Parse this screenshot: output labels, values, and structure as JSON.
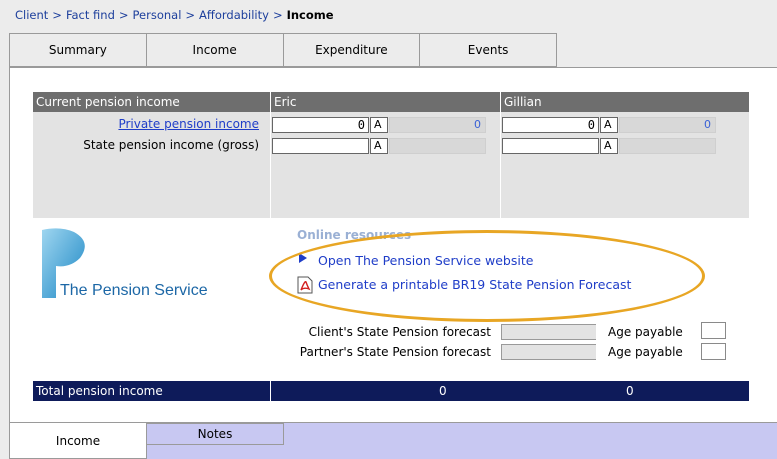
{
  "breadcrumb": {
    "items": [
      "Client",
      "Fact find",
      "Personal",
      "Affordability"
    ],
    "separator": ">",
    "current": "Income"
  },
  "tabs": [
    "Summary",
    "Income",
    "Expenditure",
    "Events"
  ],
  "table": {
    "header": {
      "label": "Current pension income",
      "person1": "Eric",
      "person2": "Gillian"
    },
    "rows": [
      {
        "label": "Private pension income",
        "p1_value": "0",
        "p1_flag": "A",
        "p1_computed": "0",
        "p2_value": "0",
        "p2_flag": "A",
        "p2_computed": "0"
      },
      {
        "label": "State pension income (gross)",
        "p1_value": "",
        "p1_flag": "A",
        "p1_computed": "",
        "p2_value": "",
        "p2_flag": "A",
        "p2_computed": ""
      }
    ]
  },
  "logo": {
    "text": "The Pension Service"
  },
  "resources": {
    "title": "Online resources",
    "links": [
      "Open The Pension Service website",
      "Generate a printable BR19 State Pension Forecast"
    ]
  },
  "forecast": {
    "client_label": "Client's State Pension forecast",
    "partner_label": "Partner's State Pension forecast",
    "age_label": "Age payable"
  },
  "total": {
    "label": "Total pension income",
    "p1": "0",
    "p2": "0"
  },
  "bottom_tabs": [
    "Income",
    "Notes"
  ],
  "colors": {
    "highlight": "#e8a624",
    "header_grey": "#6e6e6e",
    "total_bar": "#0e1b5a",
    "link": "#1f3dc8"
  }
}
